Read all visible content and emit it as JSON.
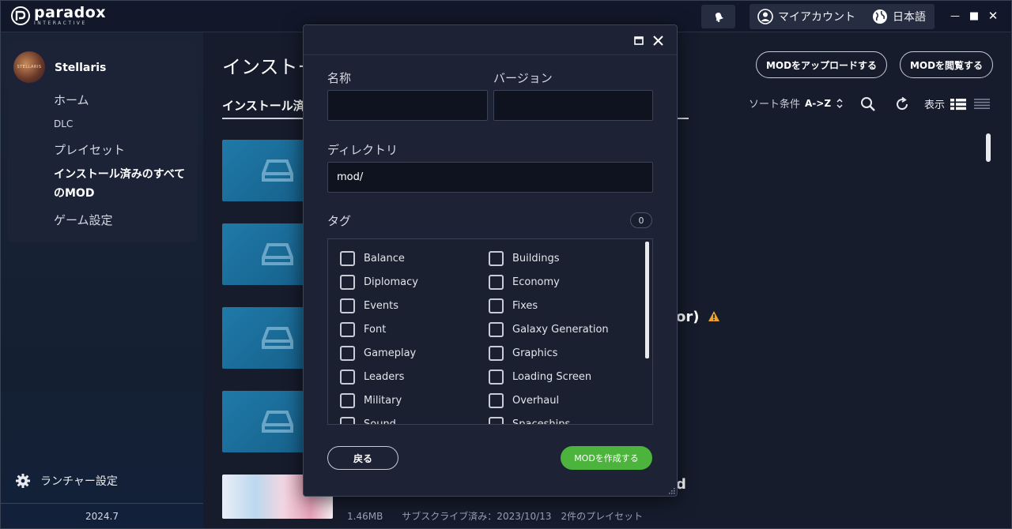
{
  "titlebar": {
    "brand": "paradox",
    "brand_sub": "INTERACTIVE",
    "account_label": "マイアカウント",
    "language_label": "日本語",
    "bell_icon": "bell-icon",
    "minimize": "—",
    "maximize": "■",
    "close": "✕"
  },
  "sidebar": {
    "game_title": "Stellaris",
    "avatar_text": "STELLARIS",
    "nav": [
      {
        "label": "ホーム"
      },
      {
        "label": "DLC"
      },
      {
        "label": "プレイセット"
      },
      {
        "label": "インストール済みのすべてのMOD"
      },
      {
        "label": "ゲーム設定"
      }
    ],
    "launcher_settings": "ランチャー設定",
    "version": "2024.7"
  },
  "main": {
    "page_title": "インストー",
    "upload_button": "MODをアップロードする",
    "browse_button": "MODを閲覧する",
    "active_tab": "インストール済",
    "sort_label": "ソート条件",
    "sort_value": "A->Z",
    "view_label": "表示",
    "peek_texts": [
      "or)",
      "d"
    ],
    "bottom_meta": "1.46MB　　サブスクライブ済み：2023/10/13　2件のプレイセット"
  },
  "modal": {
    "name_label": "名称",
    "name_value": "",
    "version_label": "バージョン",
    "version_value": "",
    "directory_label": "ディレクトリ",
    "directory_value": "mod/",
    "tags_label": "タグ",
    "tags_count": "0",
    "tags": [
      [
        "Balance",
        "Buildings"
      ],
      [
        "Diplomacy",
        "Economy"
      ],
      [
        "Events",
        "Fixes"
      ],
      [
        "Font",
        "Galaxy Generation"
      ],
      [
        "Gameplay",
        "Graphics"
      ],
      [
        "Leaders",
        "Loading Screen"
      ],
      [
        "Military",
        "Overhaul"
      ],
      [
        "Sound",
        "Spaceships"
      ]
    ],
    "back_button": "戻る",
    "create_button": "MODを作成する"
  },
  "colors": {
    "accent_green": "#4cb43c",
    "thumb_blue": "#1f7aa8",
    "warning": "#f0a030"
  }
}
